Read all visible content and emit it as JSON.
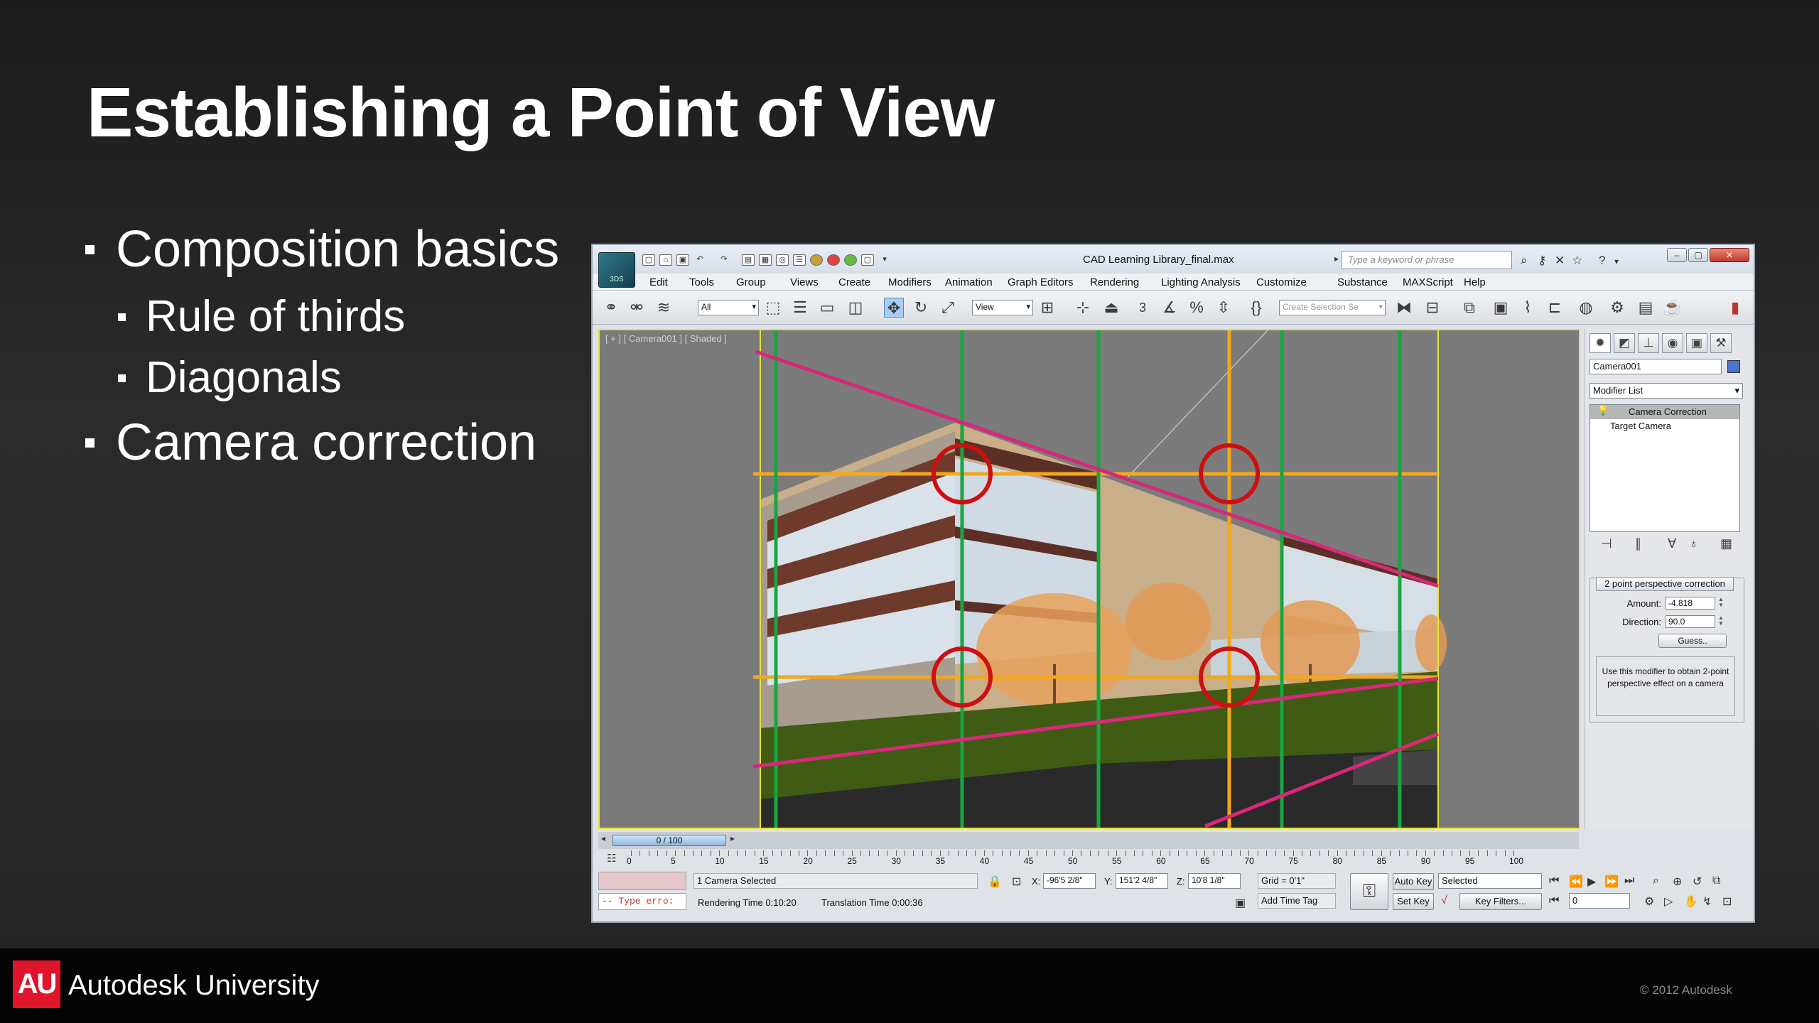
{
  "slide": {
    "title": "Establishing a Point of View",
    "bullets": [
      {
        "text": "Composition basics",
        "level": 1
      },
      {
        "text": "Rule of thirds",
        "level": 2
      },
      {
        "text": "Diagonals",
        "level": 2
      },
      {
        "text": "Camera correction",
        "level": 1
      }
    ],
    "footer": {
      "logo": "AU",
      "brand": "Autodesk University",
      "copyright": "© 2012 Autodesk"
    }
  },
  "app": {
    "title": "CAD Learning Library_final.max",
    "app_badge": "3DS",
    "search_placeholder": "Type a keyword or phrase",
    "menu": [
      "Edit",
      "Tools",
      "Group",
      "Views",
      "Create",
      "Modifiers",
      "Animation",
      "Graph Editors",
      "Rendering",
      "Lighting Analysis",
      "Customize",
      "Substance",
      "MAXScript",
      "Help"
    ],
    "toolbar": {
      "selection_filter": "All",
      "ref_coord": "View",
      "selection_set_placeholder": "Create Selection Se",
      "snap_label": "3"
    },
    "viewport": {
      "label": "[ + ] [ Camera001 ] [ Shaded ]"
    },
    "command_panel": {
      "object_name": "Camera001",
      "object_color": "#4a73c9",
      "modifier_list": "Modifier List",
      "stack": [
        "Camera Correction",
        "Target Camera"
      ],
      "rollout_title": "2 point perspective correction",
      "amount_label": "Amount:",
      "amount_value": "-4.818",
      "direction_label": "Direction:",
      "direction_value": "90.0",
      "guess_button": "Guess..",
      "help_text": "Use this modifier to obtain 2-point perspective effect on a camera"
    },
    "timeline": {
      "position": "0 / 100",
      "ticks": [
        "0",
        "5",
        "10",
        "15",
        "20",
        "25",
        "30",
        "35",
        "40",
        "45",
        "50",
        "55",
        "60",
        "65",
        "70",
        "75",
        "80",
        "85",
        "90",
        "95",
        "100"
      ]
    },
    "status": {
      "selection": "1 Camera Selected",
      "render_time": "Rendering Time  0:10:20",
      "translation_time": "Translation Time  0:00:36",
      "x_label": "X:",
      "x_value": "-96'5 2/8\"",
      "y_label": "Y:",
      "y_value": "151'2 4/8\"",
      "z_label": "Z:",
      "z_value": "10'8 1/8\"",
      "grid": "Grid = 0'1\"",
      "add_time_tag": "Add Time Tag",
      "auto_key": "Auto Key",
      "set_key": "Set Key",
      "key_mode": "Selected",
      "key_filters": "Key Filters...",
      "frame": "0",
      "maxscript_error": "-- Type erro:"
    }
  }
}
